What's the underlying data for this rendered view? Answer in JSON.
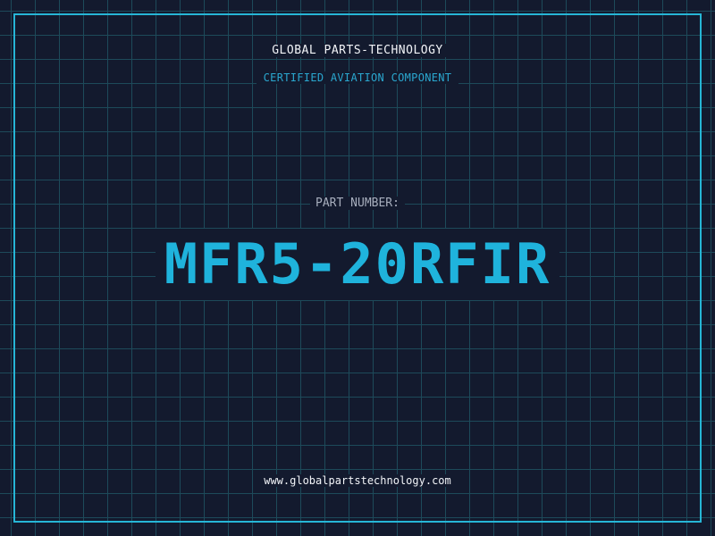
{
  "company_name": "GLOBAL PARTS-TECHNOLOGY",
  "tagline": "CERTIFIED AVIATION COMPONENT",
  "part_label": "PART NUMBER:",
  "part_number": "MFR5-20RFIR",
  "website": "www.globalpartstechnology.com",
  "colors": {
    "background": "#131a2e",
    "grid": "#1d4a5a",
    "accent": "#26b6d6",
    "text": "#f2f4f8",
    "label": "#a7aebd"
  }
}
